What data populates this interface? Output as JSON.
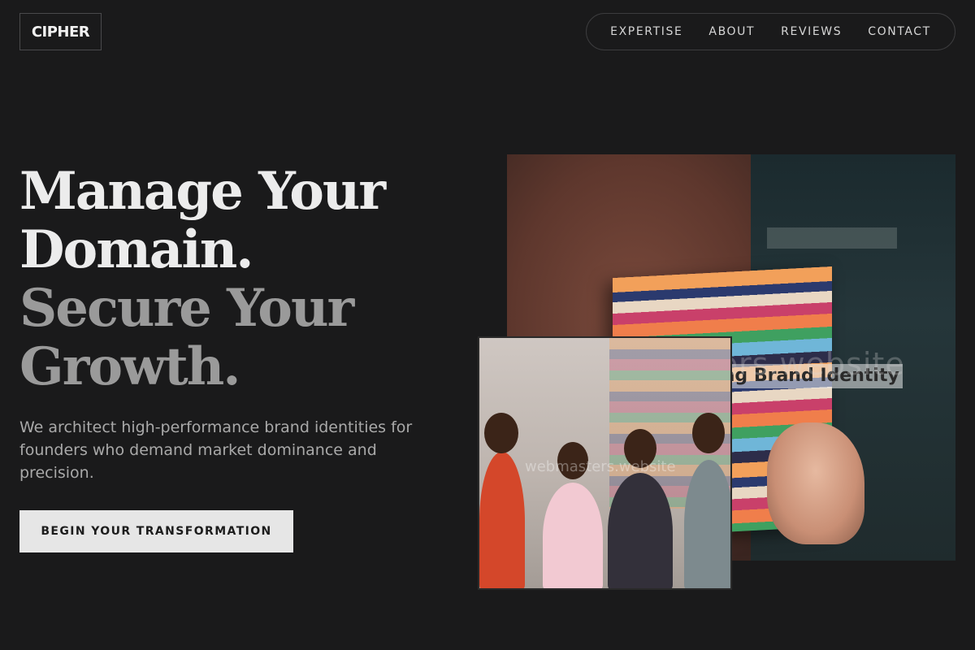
{
  "brand": {
    "logo": "CIPHER"
  },
  "nav": {
    "items": [
      {
        "label": "EXPERTISE"
      },
      {
        "label": "ABOUT"
      },
      {
        "label": "REVIEWS"
      },
      {
        "label": "CONTACT"
      }
    ]
  },
  "hero": {
    "headline": {
      "line1": "Manage Your",
      "line2": "Domain.",
      "line3": "Secure Your",
      "line4": "Growth."
    },
    "subtext": "We architect high-performance brand identities for founders who demand market dominance and precision.",
    "cta_label": "BEGIN YOUR TRANSFORMATION"
  },
  "images": {
    "main": {
      "book_title": "Designing Brand Identity",
      "watermark": "webmasters.website"
    },
    "small": {
      "watermark": "webmasters.website"
    }
  },
  "colors": {
    "background": "#1a1a1b",
    "headline_primary": "#ececec",
    "headline_secondary": "#9a9a9a",
    "cta_background": "#e6e6e6"
  }
}
